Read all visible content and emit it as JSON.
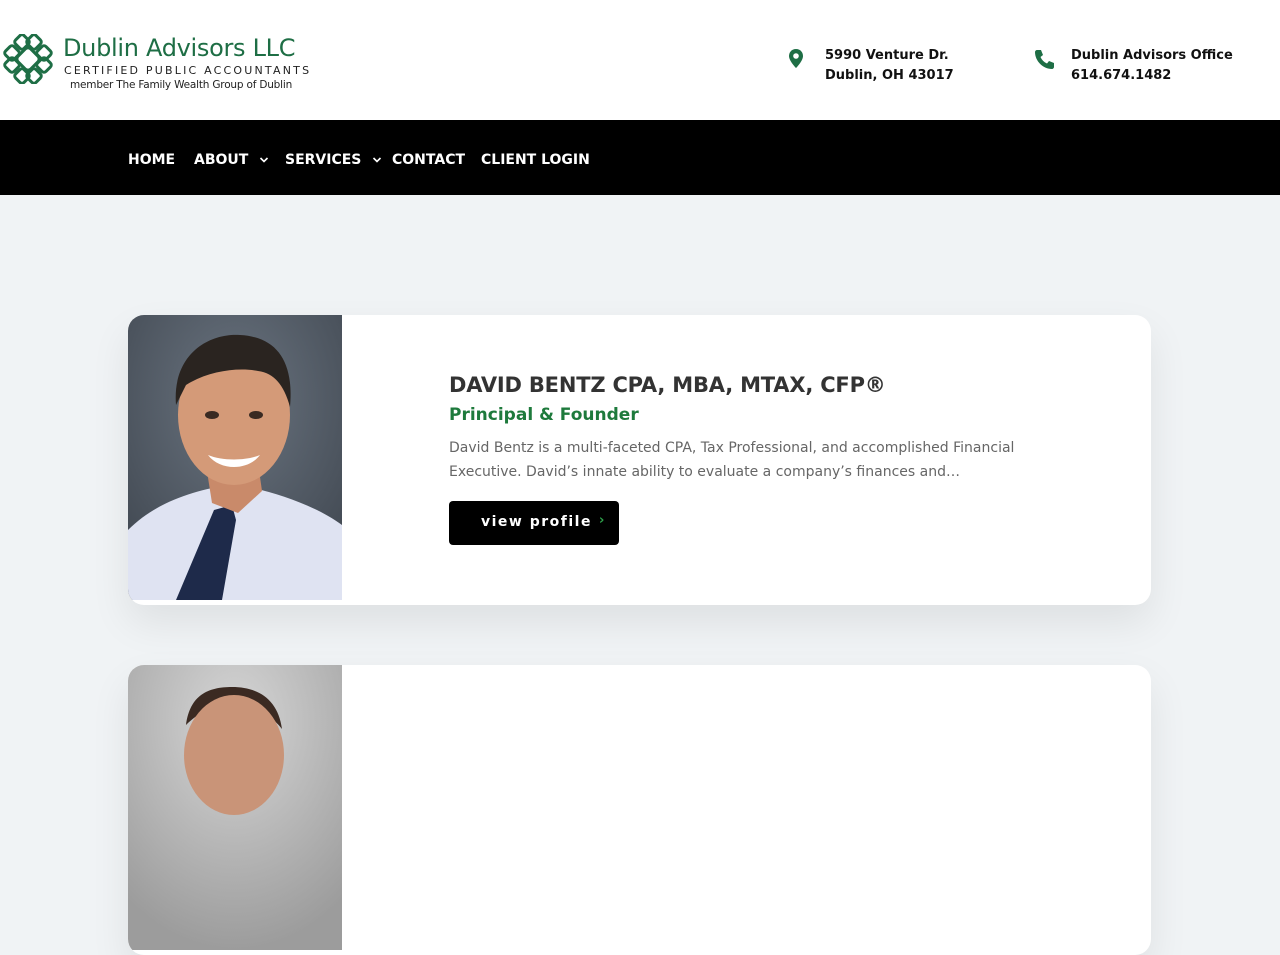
{
  "brand": {
    "name": "Dublin Advisors LLC",
    "tagline": "CERTIFIED PUBLIC ACCOUNTANTS",
    "member": "member The Family Wealth Group of Dublin",
    "color": "#1e6e45"
  },
  "contact": {
    "address": {
      "icon": "map-pin-icon",
      "line1": "5990 Venture Dr.",
      "line2": "Dublin, OH 43017"
    },
    "phone": {
      "icon": "phone-icon",
      "line1": "Dublin Advisors Office",
      "line2": "614.674.1482"
    }
  },
  "nav": {
    "items": [
      {
        "label": "HOME",
        "dropdown": false
      },
      {
        "label": "ABOUT",
        "dropdown": true
      },
      {
        "label": "SERVICES",
        "dropdown": true
      },
      {
        "label": "CONTACT",
        "dropdown": false
      },
      {
        "label": "CLIENT LOGIN",
        "dropdown": false
      }
    ]
  },
  "team": [
    {
      "name": "DAVID BENTZ CPA, MBA, MTAX, CFP®",
      "role": "Principal & Founder",
      "description": "David Bentz is a multi-faceted CPA, Tax Professional, and accomplished Financial Executive. David’s innate ability to evaluate a company’s finances and…",
      "button_label": "view profile"
    },
    {
      "name": "",
      "role": "",
      "description": "",
      "button_label": ""
    }
  ],
  "colors": {
    "accent_green": "#1e7a3c",
    "nav_bg": "#000000",
    "page_bg": "#f0f3f5"
  }
}
